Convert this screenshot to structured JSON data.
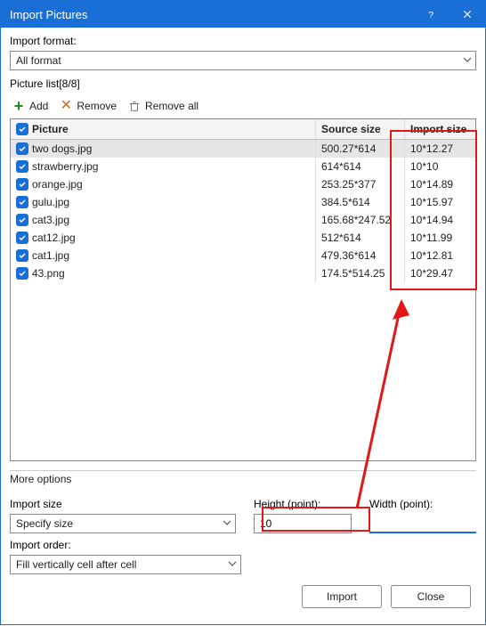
{
  "title": "Import Pictures",
  "format_label": "Import format:",
  "format_value": "All format",
  "piclist_label": "Picture list[8/8]",
  "toolbar": {
    "add": "Add",
    "remove": "Remove",
    "remove_all": "Remove all"
  },
  "table": {
    "headers": {
      "picture": "Picture",
      "source": "Source size",
      "import": "Import size"
    },
    "rows": [
      {
        "name": "two dogs.jpg",
        "source": "500.27*614",
        "import": "10*12.27",
        "selected": true
      },
      {
        "name": "strawberry.jpg",
        "source": "614*614",
        "import": "10*10",
        "selected": false
      },
      {
        "name": "orange.jpg",
        "source": "253.25*377",
        "import": "10*14.89",
        "selected": false
      },
      {
        "name": "gulu.jpg",
        "source": "384.5*614",
        "import": "10*15.97",
        "selected": false
      },
      {
        "name": "cat3.jpg",
        "source": "165.68*247.52",
        "import": "10*14.94",
        "selected": false
      },
      {
        "name": "cat12.jpg",
        "source": "512*614",
        "import": "10*11.99",
        "selected": false
      },
      {
        "name": "cat1.jpg",
        "source": "479.36*614",
        "import": "10*12.81",
        "selected": false
      },
      {
        "name": "43.png",
        "source": "174.5*514.25",
        "import": "10*29.47",
        "selected": false
      }
    ]
  },
  "more_options": "More options",
  "size_block": {
    "import_size_label": "Import size",
    "import_size_value": "Specify size",
    "height_label": "Height (point):",
    "height_value": "10",
    "width_label": "Width (point):",
    "width_value": ""
  },
  "order_block": {
    "label": "Import order:",
    "value": "Fill vertically cell after cell"
  },
  "footer": {
    "import": "Import",
    "close": "Close"
  }
}
